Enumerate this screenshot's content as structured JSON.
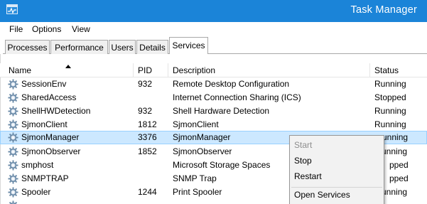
{
  "window": {
    "title": "Task Manager"
  },
  "menu": [
    "File",
    "Options",
    "View"
  ],
  "tabs": [
    "Processes",
    "Performance",
    "Users",
    "Details",
    "Services"
  ],
  "active_tab": "Services",
  "columns": {
    "name": "Name",
    "pid": "PID",
    "description": "Description",
    "status": "Status"
  },
  "sort": {
    "column": "Name",
    "direction": "ascending"
  },
  "rows": [
    {
      "name": "SessionEnv",
      "pid": "932",
      "description": "Remote Desktop Configuration",
      "status": "Running"
    },
    {
      "name": "SharedAccess",
      "pid": "",
      "description": "Internet Connection Sharing (ICS)",
      "status": "Stopped"
    },
    {
      "name": "ShellHWDetection",
      "pid": "932",
      "description": "Shell Hardware Detection",
      "status": "Running"
    },
    {
      "name": "SjmonClient",
      "pid": "1812",
      "description": "SjmonClient",
      "status": "Running"
    },
    {
      "name": "SjmonManager",
      "pid": "3376",
      "description": "SjmonManager",
      "status": "unning"
    },
    {
      "name": "SjmonObserver",
      "pid": "1852",
      "description": "SjmonObserver",
      "status": "unning"
    },
    {
      "name": "smphost",
      "pid": "",
      "description": "Microsoft Storage Spaces",
      "status": "pped"
    },
    {
      "name": "SNMPTRAP",
      "pid": "",
      "description": "SNMP Trap",
      "status": "pped"
    },
    {
      "name": "Spooler",
      "pid": "1244",
      "description": "Print Spooler",
      "status": "unning"
    },
    {
      "name": "",
      "pid": "",
      "description": "",
      "status": ""
    }
  ],
  "selected_row": "SjmonManager",
  "context_menu": {
    "items": [
      {
        "label": "Start",
        "enabled": false
      },
      {
        "label": "Stop",
        "enabled": true
      },
      {
        "label": "Restart",
        "enabled": true
      },
      {
        "label": "Open Services",
        "enabled": true
      }
    ]
  },
  "colors": {
    "titlebar": "#1b84d8",
    "selection": "#cce8ff",
    "selection_border": "#99d1ff"
  },
  "icons": {
    "app": "task-manager-icon",
    "service": "gear-icon"
  }
}
